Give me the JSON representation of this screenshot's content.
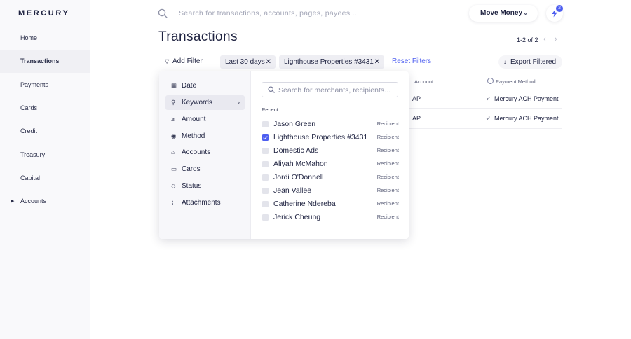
{
  "brand": {
    "logo": "MERCURY"
  },
  "sidebar": {
    "items": [
      {
        "label": "Home"
      },
      {
        "label": "Transactions"
      },
      {
        "label": "Payments"
      },
      {
        "label": "Cards"
      },
      {
        "label": "Credit"
      },
      {
        "label": "Treasury"
      },
      {
        "label": "Capital"
      },
      {
        "label": "Accounts"
      }
    ],
    "active": "Transactions"
  },
  "topbar": {
    "search_placeholder": "Search for transactions, accounts, pages, payees ...",
    "move_money_label": "Move Money",
    "notification_count": "2"
  },
  "page": {
    "title": "Transactions",
    "pagination": "1-2 of 2"
  },
  "filters": {
    "add_filter_label": "Add Filter",
    "chips": [
      {
        "label": "Last 30 days"
      },
      {
        "label": "Lighthouse Properties #3431"
      }
    ],
    "reset_label": "Reset Filters",
    "export_label": "Export Filtered"
  },
  "table": {
    "headers": {
      "account": "Account",
      "payment_method": "Payment Method"
    },
    "rows": [
      {
        "account": "AP",
        "payment_method": "Mercury ACH Payment"
      },
      {
        "account": "AP",
        "payment_method": "Mercury ACH Payment"
      }
    ]
  },
  "filter_menu": {
    "items": [
      {
        "label": "Date",
        "icon": "calendar-icon"
      },
      {
        "label": "Keywords",
        "icon": "search-icon"
      },
      {
        "label": "Amount",
        "icon": "greater-equal-icon"
      },
      {
        "label": "Method",
        "icon": "method-icon"
      },
      {
        "label": "Accounts",
        "icon": "bank-icon"
      },
      {
        "label": "Cards",
        "icon": "card-icon"
      },
      {
        "label": "Status",
        "icon": "tag-icon"
      },
      {
        "label": "Attachments",
        "icon": "paperclip-icon"
      }
    ],
    "active": "Keywords"
  },
  "keywords": {
    "search_placeholder": "Search for merchants, recipients...",
    "recent_label": "Recent",
    "recent": [
      {
        "name": "Jason Green",
        "type": "Recipient",
        "checked": false
      },
      {
        "name": "Lighthouse Properties #3431",
        "type": "Recipient",
        "checked": true
      },
      {
        "name": "Domestic Ads",
        "type": "Recipient",
        "checked": false
      },
      {
        "name": "Aliyah McMahon",
        "type": "Recipient",
        "checked": false
      },
      {
        "name": "Jordi O'Donnell",
        "type": "Recipient",
        "checked": false
      },
      {
        "name": "Jean Vallee",
        "type": "Recipient",
        "checked": false
      },
      {
        "name": "Catherine Ndereba",
        "type": "Recipient",
        "checked": false
      },
      {
        "name": "Jerick Cheung",
        "type": "Recipient",
        "checked": false
      }
    ]
  },
  "colors": {
    "accent": "#4d5ef0",
    "text": "#1e2240",
    "sidebar_bg": "#f9f9fb"
  }
}
